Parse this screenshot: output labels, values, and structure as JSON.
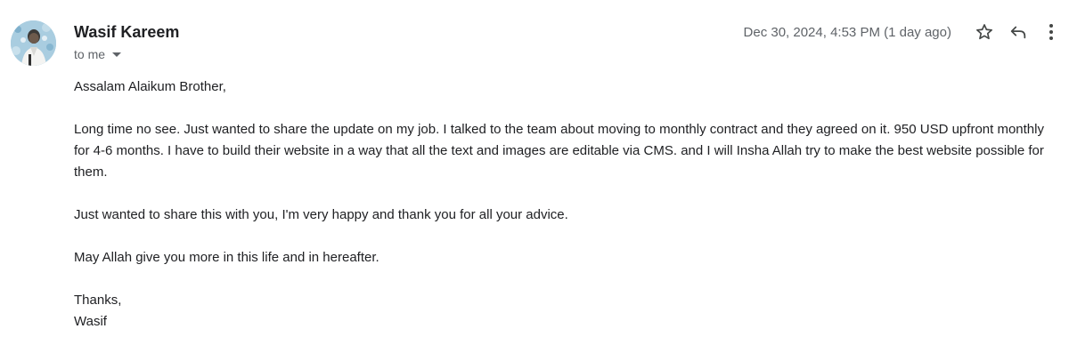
{
  "sender": {
    "name": "Wasif Kareem",
    "avatar_icon": "profile-photo"
  },
  "recipient": {
    "label": "to me",
    "toggle_icon": "caret-down-icon"
  },
  "date": "Dec 30, 2024, 4:53 PM (1 day ago)",
  "actions": {
    "star_icon": "star-icon",
    "reply_icon": "reply-icon",
    "more_icon": "more-vert-icon"
  },
  "message": {
    "greeting": "Assalam Alaikum Brother,",
    "paragraph1": "Long time no see. Just wanted to share the update on my job. I talked to the team about moving to monthly contract and they agreed on it. 950 USD upfront monthly for 4-6 months. I have to build their website in a way that all the text and images are editable via CMS. and I will Insha Allah try to make the best website possible for them.",
    "paragraph2": "Just wanted to share this with you, I'm very happy and thank you for all your advice.",
    "paragraph3": "May Allah give you more in this life and in hereafter.",
    "signoff": "Thanks,",
    "signature": "Wasif"
  },
  "colors": {
    "text": "#202124",
    "muted": "#5f6368",
    "avatar_bg": "#9fc6db"
  }
}
